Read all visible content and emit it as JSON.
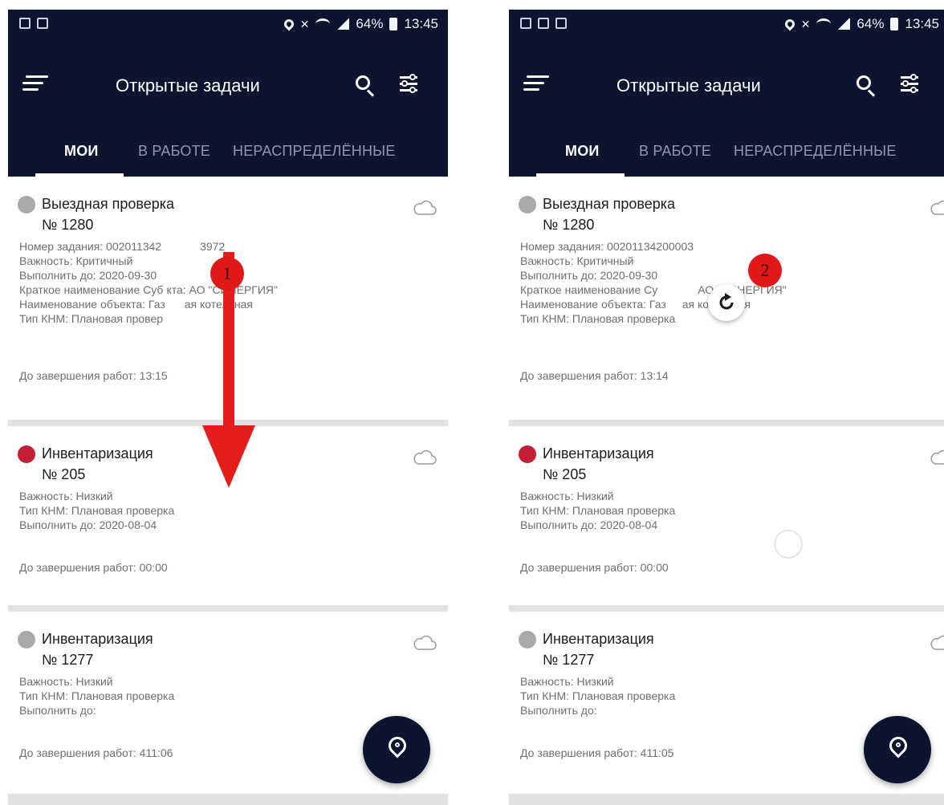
{
  "status_bar": {
    "time": "13:45",
    "battery": "64%"
  },
  "toolbar": {
    "title": "Открытые задачи"
  },
  "tabs": [
    {
      "label": "МОИ",
      "active": true
    },
    {
      "label": "В РАБОТЕ",
      "active": false
    },
    {
      "label": "НЕРАСПРЕДЕЛЁННЫЕ",
      "active": false
    }
  ],
  "phone1": {
    "tasks": [
      {
        "title": "Выездная проверка",
        "number": "№ 1280",
        "status_color": "#a9a9a9",
        "lines": [
          "Номер задания: 002011342",
          "Важность: Критичный",
          "Выполнить до: 2020-09-30",
          "Краткое наименование Суб",
          "Наименование объекта: Газ",
          "Тип КНМ: Плановая провер"
        ],
        "lines_right": [
          "3972",
          "",
          "",
          "кта: АО \"СИНЕРГИЯ\"",
          "ая котельная",
          ""
        ],
        "deadline": "До завершения работ: 13:15"
      },
      {
        "title": "Инвентаризация",
        "number": "№ 205",
        "status_color": "#c41e34",
        "lines": [
          "Важность: Низкий",
          "Тип КНМ: Плановая проверка",
          "Выполнить до: 2020-08-04"
        ],
        "deadline": "До завершения работ: 00:00"
      },
      {
        "title": "Инвентаризация",
        "number": "№ 1277",
        "status_color": "#a9a9a9",
        "lines": [
          "Важность: Низкий",
          "Тип КНМ: Плановая проверка",
          "Выполнить до:"
        ],
        "deadline": "До завершения работ: 411:06"
      }
    ]
  },
  "phone2": {
    "tasks": [
      {
        "title": "Выездная проверка",
        "number": "№ 1280",
        "status_color": "#a9a9a9",
        "lines": [
          "Номер задания: 00201134200003",
          "Важность: Критичный",
          "Выполнить до: 2020-09-30",
          "Краткое наименование Су",
          "Наименование объекта: Газ",
          "Тип КНМ: Плановая проверка"
        ],
        "lines_right": [
          "",
          "",
          "",
          "АО \"СИНЕРГИЯ\"",
          "ая котельная",
          ""
        ],
        "deadline": "До завершения работ: 13:14"
      },
      {
        "title": "Инвентаризация",
        "number": "№ 205",
        "status_color": "#c41e34",
        "lines": [
          "Важность: Низкий",
          "Тип КНМ: Плановая проверка",
          "Выполнить до: 2020-08-04"
        ],
        "deadline": "До завершения работ: 00:00"
      },
      {
        "title": "Инвентаризация",
        "number": "№ 1277",
        "status_color": "#a9a9a9",
        "lines": [
          "Важность: Низкий",
          "Тип КНМ: Плановая проверка",
          "Выполнить до:"
        ],
        "deadline": "До завершения работ: 411:05"
      }
    ]
  },
  "annotations": {
    "step1": "1",
    "step2": "2"
  },
  "colors": {
    "app_bar": "#0b1530",
    "accent_red": "#e01818"
  },
  "icons": {
    "menu": "hamburger-icon",
    "search": "search-icon",
    "filter": "filter-icon",
    "sync": "cloud-icon",
    "map": "location-pin-icon"
  }
}
